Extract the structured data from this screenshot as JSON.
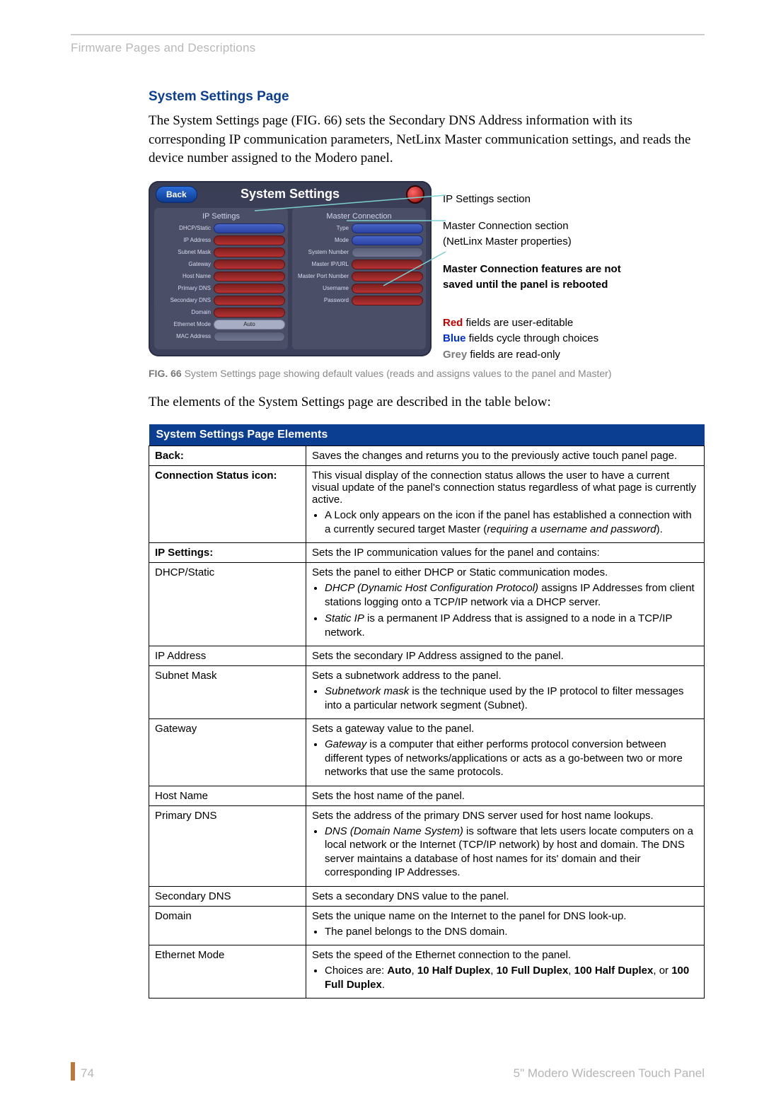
{
  "header": {
    "category": "Firmware Pages and Descriptions"
  },
  "h2": "System Settings Page",
  "intro": "The System Settings page (FIG. 66) sets the Secondary DNS Address information with its corresponding IP communication parameters, NetLinx Master communication settings, and reads the device number assigned to the Modero panel.",
  "screenshot": {
    "back": "Back",
    "title": "System Settings",
    "col1": {
      "head": "IP Settings",
      "rows": [
        "DHCP/Static",
        "IP Address",
        "Subnet Mask",
        "Gateway",
        "Host Name",
        "Primary DNS",
        "Secondary DNS",
        "Domain",
        "Ethernet Mode",
        "MAC Address"
      ],
      "auto": "Auto"
    },
    "col2": {
      "head": "Master Connection",
      "rows": [
        "Type",
        "Mode",
        "System Number",
        "Master IP/URL",
        "Master Port Number",
        "Username",
        "Password"
      ]
    }
  },
  "annot": {
    "a1": "IP Settings section",
    "a2a": "Master Connection section",
    "a2b": "(NetLinx Master properties)",
    "a3a": "Master Connection features are not",
    "a3b": "saved until the panel is rebooted",
    "red": "Red",
    "redtxt": " fields are user-editable",
    "blue": "Blue",
    "bluetxt": " fields cycle through choices",
    "grey": "Grey",
    "greytxt": " fields are read-only"
  },
  "figcap_b": "FIG. 66",
  "figcap": "  System Settings page showing default values (reads and assigns values to the panel and Master)",
  "lead": "The elements of the System Settings page are described in the table below:",
  "table": {
    "header": "System Settings Page Elements",
    "rows": [
      {
        "l": "Back:",
        "bold": true,
        "r": "Saves the changes and returns you to the previously active touch panel page."
      },
      {
        "l": "Connection Status icon:",
        "bold": true,
        "r": "This visual display of the connection status allows the user to have a current visual update of the panel's connection status regardless of what page is currently active.",
        "bul": [
          "A Lock only appears on the icon if the panel has established a connection with a currently secured target Master (<em>requiring a username and password</em>)."
        ]
      },
      {
        "l": "IP Settings:",
        "bold": true,
        "r": "Sets the IP communication values for the panel and contains:"
      },
      {
        "l": "DHCP/Static",
        "sub": true,
        "r": "Sets the panel to either DHCP or Static communication modes.",
        "bul": [
          "<em>DHCP (Dynamic Host Configuration Protocol)</em> assigns IP Addresses from client stations logging onto a TCP/IP network via a DHCP server.",
          "<em>Static IP</em> is a permanent IP Address that is assigned to a node in a TCP/IP network."
        ]
      },
      {
        "l": "IP Address",
        "sub": true,
        "r": "Sets the secondary IP Address assigned to the panel."
      },
      {
        "l": "Subnet Mask",
        "sub": true,
        "r": "Sets a subnetwork address to the panel.",
        "bul": [
          "<em>Subnetwork mask</em> is the technique used by the IP protocol to filter messages into a particular network segment (Subnet)."
        ]
      },
      {
        "l": "Gateway",
        "sub": true,
        "r": "Sets a gateway value to the panel.",
        "bul": [
          "<em>Gateway</em> is a computer that either performs protocol conversion between different types of networks/applications or acts as a go-between two or more networks that use the same protocols."
        ]
      },
      {
        "l": "Host Name",
        "sub": true,
        "r": "Sets the host name of the panel."
      },
      {
        "l": "Primary DNS",
        "sub": true,
        "r": "Sets the address of the primary DNS server used for host name lookups.",
        "bul": [
          "<em>DNS (Domain Name System)</em> is software that lets users locate computers on a local network or the Internet (TCP/IP network) by host and domain. The DNS server maintains a database of host names for its' domain and their corresponding IP Addresses."
        ]
      },
      {
        "l": "Secondary DNS",
        "sub": true,
        "r": "Sets a secondary DNS value to the panel."
      },
      {
        "l": "Domain",
        "sub": true,
        "r": "Sets the unique name on the Internet to the panel for DNS look-up.",
        "bul": [
          "The panel belongs to the DNS domain."
        ]
      },
      {
        "l": "Ethernet Mode",
        "sub": true,
        "r": "Sets the speed of the Ethernet connection to the panel.",
        "bul": [
          "Choices are: <b>Auto</b>, <b>10 Half Duplex</b>, <b>10 Full Duplex</b>, <b>100 Half Duplex</b>, or <b>100 Full Duplex</b>."
        ]
      }
    ]
  },
  "footer": {
    "page": "74",
    "right": "5\" Modero Widescreen Touch Panel"
  }
}
